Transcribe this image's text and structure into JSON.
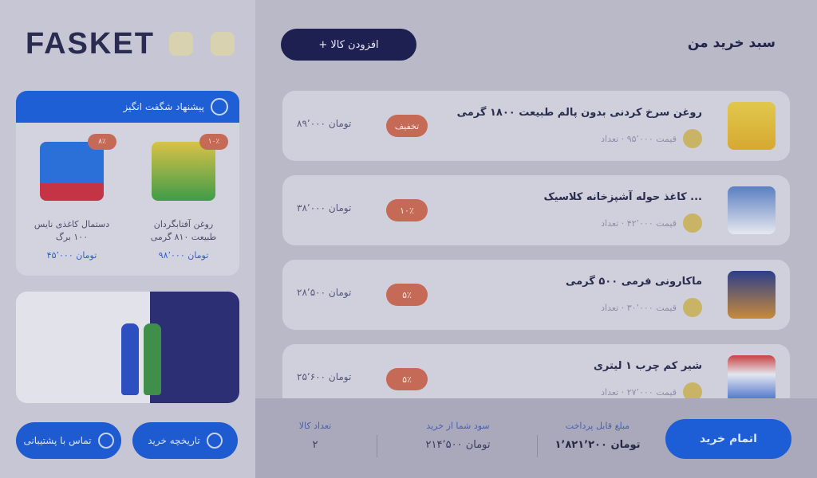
{
  "cart": {
    "title": "سبد خرید من",
    "add_button": "+ افزودن کالا",
    "items": [
      {
        "name": "روغن سرخ کردنی بدون پالم طبیعت ۱۸۰۰ گرمی",
        "meta": "قیمت ۹۵٬۰۰۰ · تعداد",
        "badge": "تخفیف",
        "price": "۸۹٬۰۰۰ تومان",
        "icon": "oil-bottle"
      },
      {
        "name": "کاغذ حوله آشپزخانه کلاسیک ...",
        "meta": "قیمت ۴۲٬۰۰۰ · تعداد",
        "badge": "۱۰٪",
        "price": "۳۸٬۰۰۰ تومان",
        "icon": "paper-towel"
      },
      {
        "name": "ماکارونی فرمی ۵۰۰ گرمی",
        "meta": "قیمت ۳۰٬۰۰۰ · تعداد",
        "badge": "۵٪",
        "price": "۲۸٬۵۰۰ تومان",
        "icon": "pasta-box"
      },
      {
        "name": "شیر کم چرب ۱ لیتری",
        "meta": "قیمت ۲۷٬۰۰۰ · تعداد",
        "badge": "۵٪",
        "price": "۲۵٬۶۰۰ تومان",
        "icon": "milk-bottle"
      }
    ]
  },
  "summary": {
    "checkout_button": "اتمام خرید",
    "payable_label": "مبلغ قابل پرداخت",
    "payable_value": "۱٬۸۲۱٬۲۰۰ تومان",
    "discount_label": "سود شما از خرید",
    "discount_value": "۲۱۴٬۵۰۰ تومان",
    "count_label": "تعداد کالا",
    "count_value": "۲"
  },
  "sidebar": {
    "logo": "FASKET",
    "offers_title": "پیشنهاد شگفت انگیز",
    "offers": [
      {
        "name": "روغن آفتابگردان طبیعت ۸۱۰ گرمی",
        "price": "۹۸٬۰۰۰ تومان",
        "badge": "۱۰٪",
        "icon": "oil-bottle"
      },
      {
        "name": "دستمال کاغذی نایس ۱۰۰ برگ",
        "price": "۴۵٬۰۰۰ تومان",
        "badge": "۸٪",
        "icon": "tissue-box"
      }
    ],
    "left_button": "تماس با پشتیبانی",
    "right_button": "تاریخچه خرید"
  },
  "colors": {
    "primary": "#1f5fd6",
    "navy": "#1e2052",
    "discount": "#c46a56"
  }
}
